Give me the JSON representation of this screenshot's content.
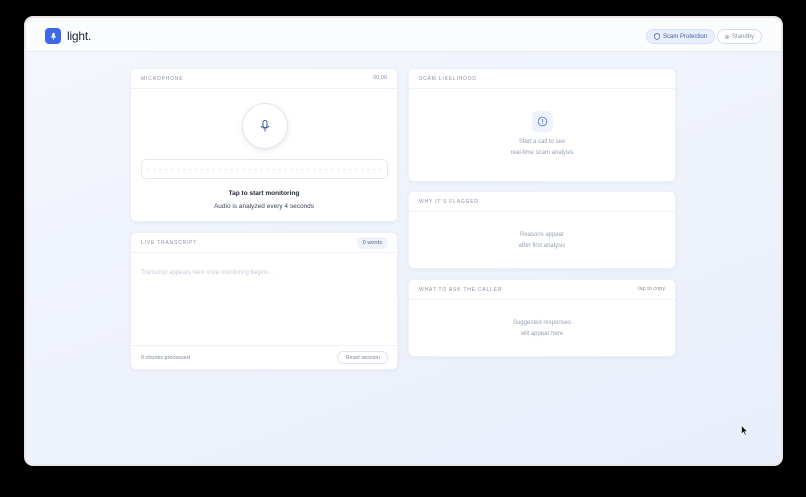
{
  "app": {
    "logo_text": "light.",
    "scam_protection_label": "Scam Protection",
    "standby_label": "Standby"
  },
  "microphone": {
    "title": "MICROPHONE",
    "timer": "00:00",
    "status": "Tap to start monitoring",
    "subtitle": "Audio is analyzed every 4 seconds"
  },
  "transcript": {
    "title": "LIVE TRANSCRIPT",
    "words_badge": "0 words",
    "placeholder": "Transcript appears here once monitoring begins...",
    "chunks": "0 chunks processed",
    "reset_label": "Reset session"
  },
  "likelihood": {
    "title": "SCAM LIKELIHOOD",
    "line1": "Start a call to see",
    "line2": "real-time scam analysis"
  },
  "why": {
    "title": "WHY IT'S FLAGGED",
    "line1": "Reasons appear",
    "line2": "after first analysis"
  },
  "ask": {
    "title": "WHAT TO ASK THE CALLER",
    "hint": "tap to copy",
    "line1": "Suggested responses",
    "line2": "will appear here"
  },
  "colors": {
    "accent": "#3e68e6",
    "background": "#eef2fb",
    "card": "#ffffff"
  }
}
